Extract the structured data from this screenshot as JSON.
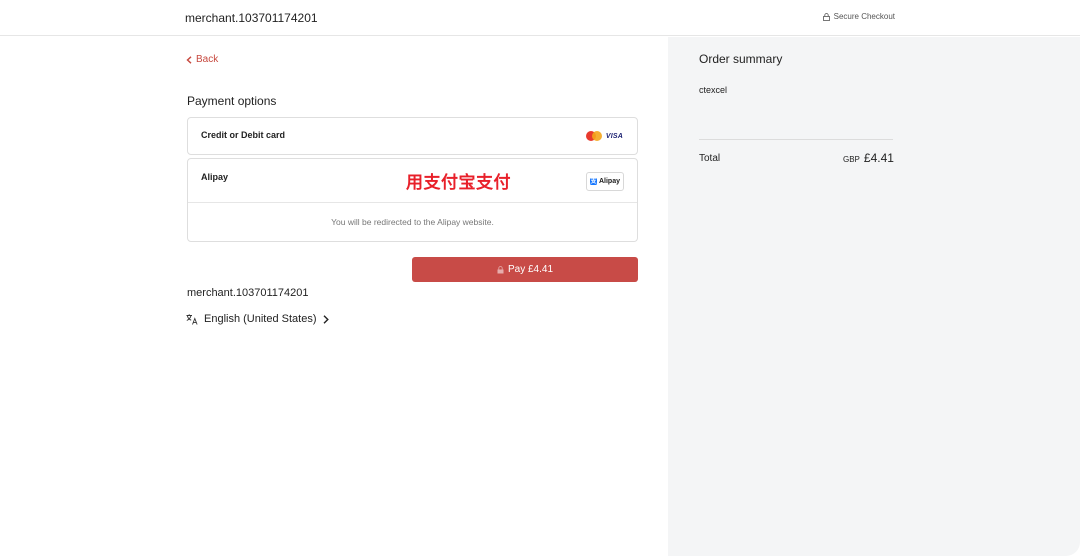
{
  "header": {
    "merchant": "merchant.103701174201",
    "secure_label": "Secure Checkout",
    "lock_icon": "lock-icon"
  },
  "nav": {
    "back_label": "Back",
    "back_icon": "chevron-left-icon"
  },
  "payment": {
    "heading": "Payment options",
    "card_option": {
      "label": "Credit or Debit card",
      "brand_visa": "VISA",
      "brand_icons": [
        "mastercard-icon",
        "visa-icon"
      ]
    },
    "alipay_option": {
      "label": "Alipay",
      "annotation": "用支付宝支付",
      "badge_text": "Alipay",
      "badge_glyph": "支",
      "redirect_text": "You will be redirected to the Alipay website."
    },
    "pay_button_label": "Pay £4.41"
  },
  "footer": {
    "merchant": "merchant.103701174201",
    "language": "English (United States)",
    "language_icon": "translate-icon"
  },
  "summary": {
    "title": "Order summary",
    "product": "ctexcel",
    "total_label": "Total",
    "currency": "GBP",
    "total_value": "£4.41"
  },
  "colors": {
    "accent": "#c84b47",
    "link": "#c7483e",
    "annotation": "#e8202a",
    "summary_bg": "#f4f5f6"
  }
}
